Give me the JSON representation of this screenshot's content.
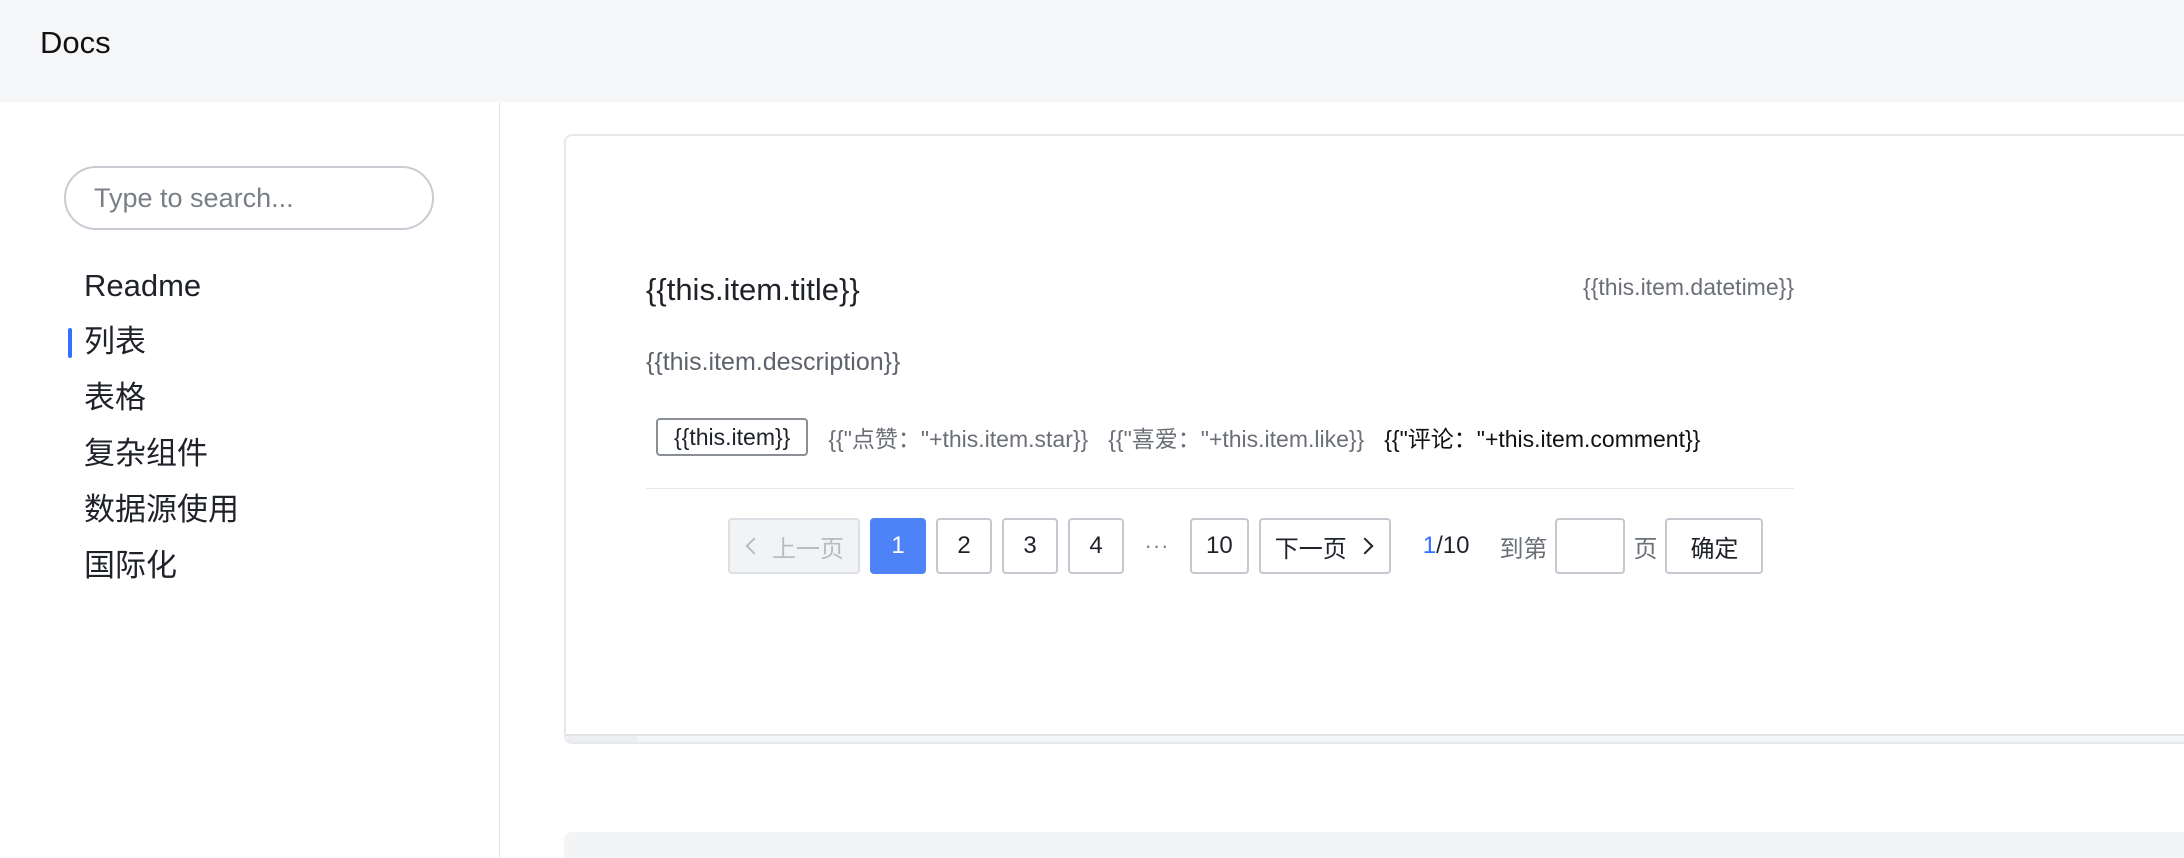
{
  "header": {
    "brand": "Docs"
  },
  "sidebar": {
    "search_placeholder": "Type to search...",
    "items": [
      {
        "label": "Readme",
        "active": false
      },
      {
        "label": "列表",
        "active": true
      },
      {
        "label": "表格",
        "active": false
      },
      {
        "label": "复杂组件",
        "active": false
      },
      {
        "label": "数据源使用",
        "active": false
      },
      {
        "label": "国际化",
        "active": false
      }
    ]
  },
  "list_item": {
    "title": "{{this.item.title}}",
    "datetime": "{{this.item.datetime}}",
    "description": "{{this.item.description}}",
    "tag": "{{this.item}}",
    "star": "{{\"点赞：\"+this.item.star}}",
    "like": "{{\"喜爱：\"+this.item.like}}",
    "comment": "{{\"评论：\"+this.item.comment}}"
  },
  "pagination": {
    "prev_label": "上一页",
    "next_label": "下一页",
    "pages": [
      "1",
      "2",
      "3",
      "4"
    ],
    "ellipsis": "···",
    "last_page": "10",
    "current": "1",
    "total": "/10",
    "goto_prefix": "到第",
    "goto_suffix": "页",
    "confirm_label": "确定"
  },
  "code_toggle": {
    "icon": "code-icon",
    "glyph": "<>"
  }
}
